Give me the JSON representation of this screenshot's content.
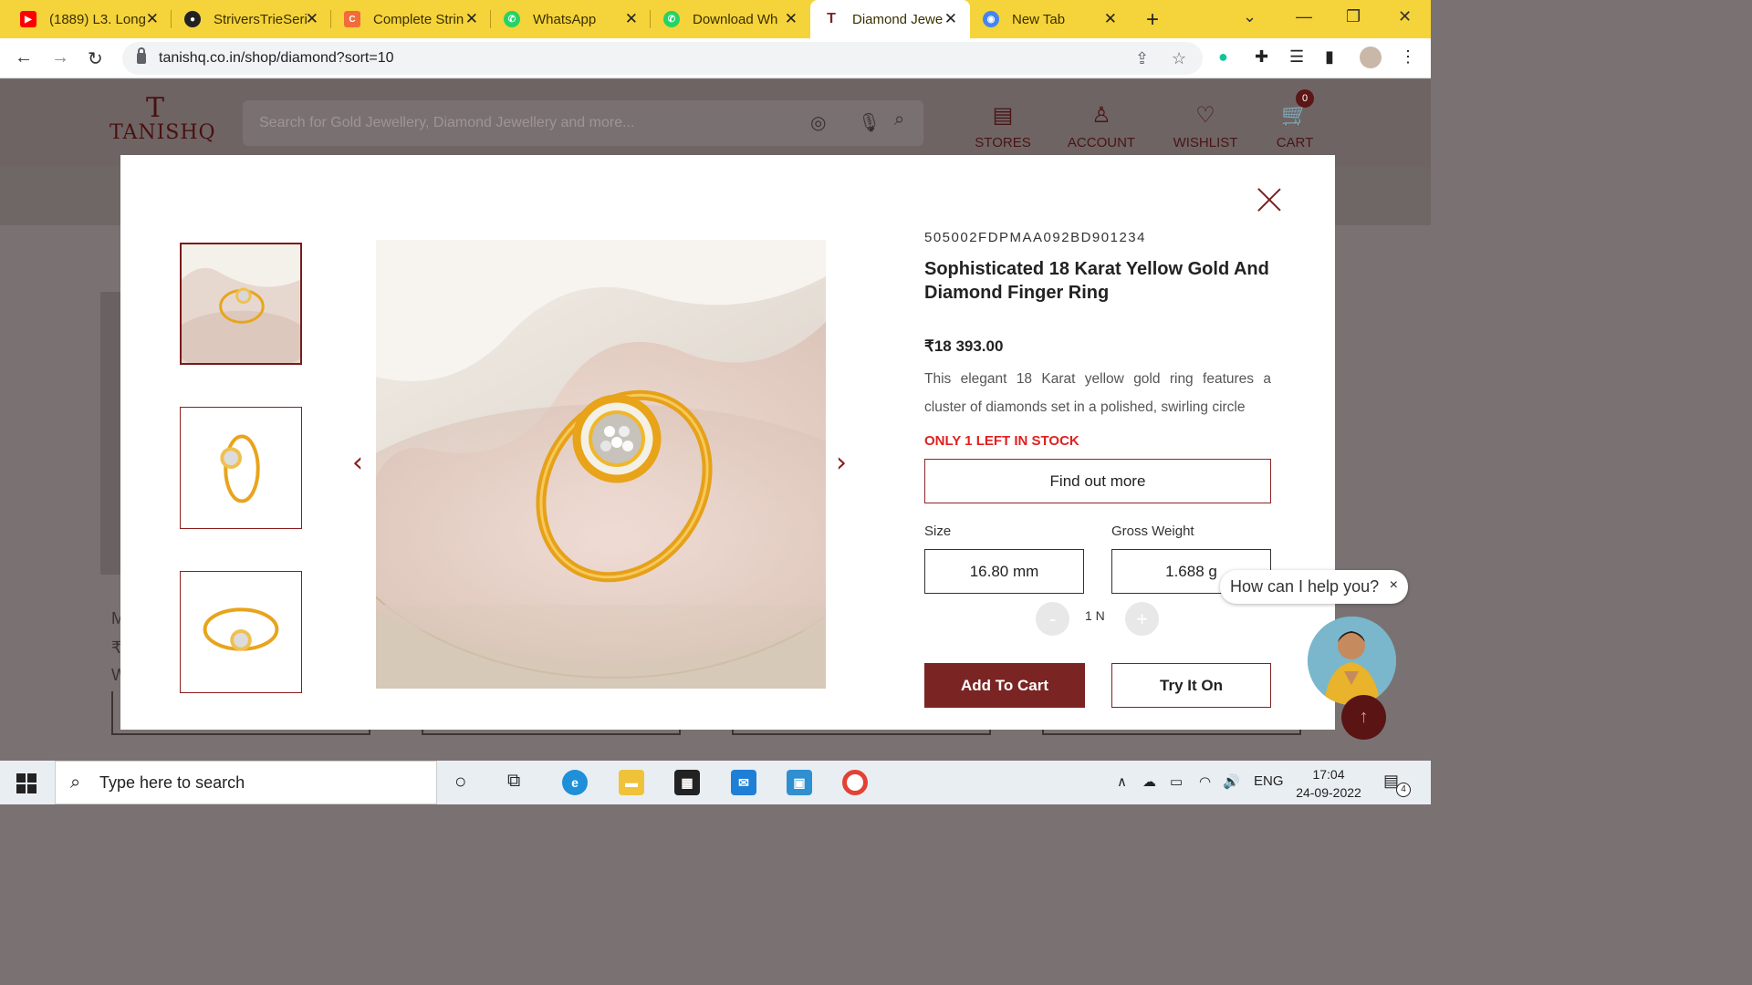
{
  "browser": {
    "tabs": [
      {
        "label": "(1889) L3. Long",
        "icon": "youtube-icon",
        "color": "#ff0000"
      },
      {
        "label": "StriversTrieSeri",
        "icon": "github-icon",
        "color": "#222222"
      },
      {
        "label": "Complete Strin",
        "icon": "codestudio-icon",
        "color": "#f26b3a"
      },
      {
        "label": "WhatsApp",
        "icon": "whatsapp-icon",
        "color": "#25d366"
      },
      {
        "label": "Download Wh",
        "icon": "whatsapp-icon",
        "color": "#25d366"
      },
      {
        "label": "Diamond Jewe",
        "icon": "tanishq-icon",
        "color": "#7a2424"
      },
      {
        "label": "New Tab",
        "icon": "chrome-icon",
        "color": "#4285f4"
      }
    ],
    "url": "tanishq.co.in/shop/diamond?sort=10"
  },
  "site": {
    "logo_mark": "T",
    "logo_text": "TANISHQ",
    "search_placeholder": "Search for Gold Jewellery, Diamond Jewellery and more...",
    "nav": [
      {
        "label": "STORES",
        "icon": "store-icon"
      },
      {
        "label": "ACCOUNT",
        "icon": "user-icon"
      },
      {
        "label": "WISHLIST",
        "icon": "heart-icon"
      },
      {
        "label": "CART",
        "icon": "cart-icon"
      }
    ],
    "cart_count": "0",
    "bg_letters": [
      "M",
      "₹",
      "W"
    ]
  },
  "product": {
    "sku": "505002FDPMAA092BD901234",
    "title": "Sophisticated 18 Karat Yellow Gold And Diamond Finger Ring",
    "price": "₹18 393.00",
    "description": "This elegant 18 Karat yellow gold ring features a cluster of diamonds set in a polished, swirling circle",
    "stock": "ONLY 1 LEFT IN STOCK",
    "find_out_more": "Find out more",
    "size_label": "Size",
    "size_value": "16.80 mm",
    "weight_label": "Gross Weight",
    "weight_value": "1.688 g",
    "qty_minus": "-",
    "qty_value": "1 N",
    "qty_plus": "+",
    "add_to_cart": "Add To Cart",
    "try_it_on": "Try It On",
    "stock_color": "#e02020",
    "accent": "#7a2424"
  },
  "chat": {
    "text": "How can I help you?",
    "close": "×"
  },
  "taskbar": {
    "search_placeholder": "Type here to search",
    "lang": "ENG",
    "time": "17:04",
    "date": "24-09-2022",
    "notifications": "4"
  }
}
